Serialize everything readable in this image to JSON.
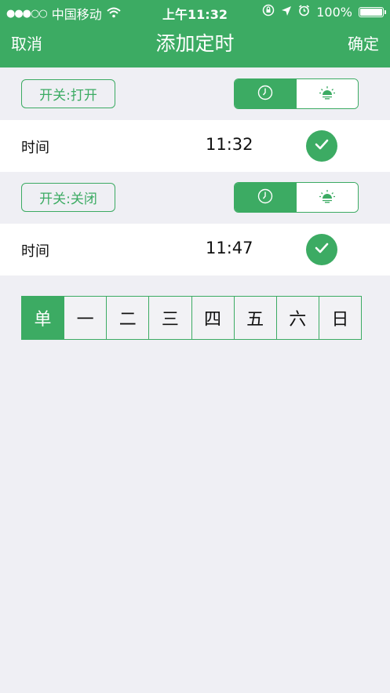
{
  "status_bar": {
    "carrier": "中国移动",
    "time": "上午11:32",
    "battery": "100%"
  },
  "nav": {
    "cancel": "取消",
    "title": "添加定时",
    "confirm": "确定"
  },
  "timers": [
    {
      "switch_label": "开关:打开",
      "time_label": "时间",
      "time": "11:32"
    },
    {
      "switch_label": "开关:关闭",
      "time_label": "时间",
      "time": "11:47"
    }
  ],
  "days": [
    "单",
    "一",
    "二",
    "三",
    "四",
    "五",
    "六",
    "日"
  ],
  "selected_day": "单",
  "colors": {
    "accent": "#3cab63",
    "background": "#efeff4"
  }
}
